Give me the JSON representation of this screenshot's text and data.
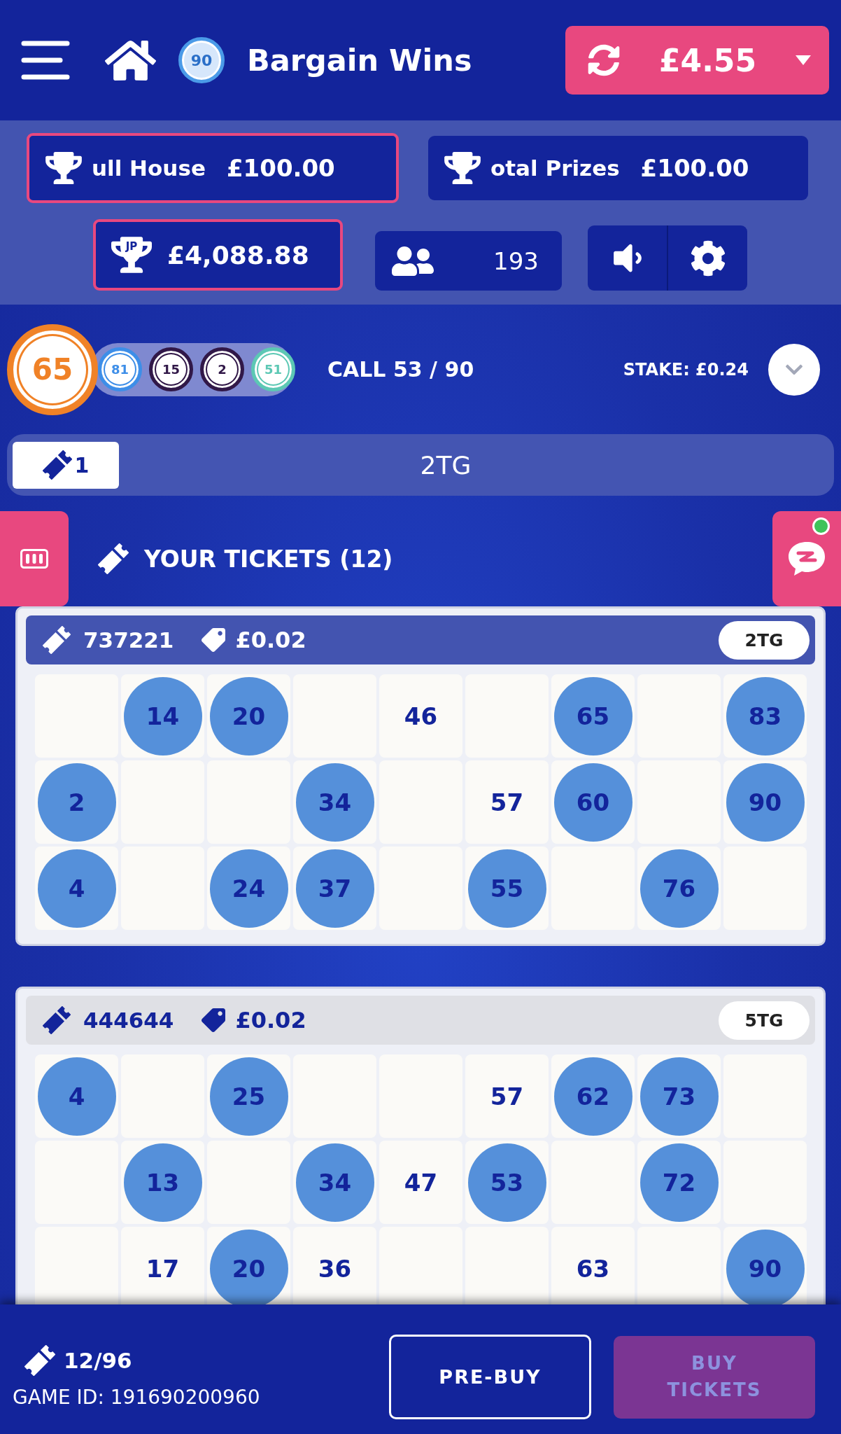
{
  "header": {
    "game_ball": "90",
    "title": "Bargain Wins",
    "balance": "£4.55"
  },
  "prizes": [
    {
      "label": "ull House",
      "amount": "£100.00",
      "highlighted": true
    },
    {
      "label": "otal Prizes",
      "amount": "£100.00",
      "highlighted": false
    }
  ],
  "jackpot": {
    "badge": "JP",
    "amount": "£4,088.88",
    "highlighted": true
  },
  "players": {
    "count": "193"
  },
  "calls": {
    "current": "65",
    "recent": [
      {
        "number": "81",
        "color": "#3d8ee8"
      },
      {
        "number": "15",
        "color": "#311848"
      },
      {
        "number": "2",
        "color": "#311848"
      },
      {
        "number": "51",
        "color": "#5cc8b4"
      }
    ],
    "progress": "CALL 53 / 90",
    "stake": "STAKE: £0.24"
  },
  "ticket_bar": {
    "count": "1",
    "label": "2TG"
  },
  "tickets_heading": "YOUR TICKETS (12)",
  "chat": {
    "notification": true
  },
  "tickets": [
    {
      "id": "737221",
      "price": "£0.02",
      "to_go": "2TG",
      "active": true,
      "rows": [
        [
          {
            "kind": "blank"
          },
          {
            "kind": "number",
            "number": "14",
            "marked": true
          },
          {
            "kind": "number",
            "number": "20",
            "marked": true
          },
          {
            "kind": "blank"
          },
          {
            "kind": "number",
            "number": "46",
            "marked": false
          },
          {
            "kind": "blank"
          },
          {
            "kind": "number",
            "number": "65",
            "marked": true
          },
          {
            "kind": "blank"
          },
          {
            "kind": "number",
            "number": "83",
            "marked": true
          }
        ],
        [
          {
            "kind": "number",
            "number": "2",
            "marked": true
          },
          {
            "kind": "blank"
          },
          {
            "kind": "blank"
          },
          {
            "kind": "number",
            "number": "34",
            "marked": true
          },
          {
            "kind": "blank"
          },
          {
            "kind": "number",
            "number": "57",
            "marked": false
          },
          {
            "kind": "number",
            "number": "60",
            "marked": true
          },
          {
            "kind": "blank"
          },
          {
            "kind": "number",
            "number": "90",
            "marked": true
          }
        ],
        [
          {
            "kind": "number",
            "number": "4",
            "marked": true
          },
          {
            "kind": "blank"
          },
          {
            "kind": "number",
            "number": "24",
            "marked": true
          },
          {
            "kind": "number",
            "number": "37",
            "marked": true
          },
          {
            "kind": "blank"
          },
          {
            "kind": "number",
            "number": "55",
            "marked": true
          },
          {
            "kind": "blank"
          },
          {
            "kind": "number",
            "number": "76",
            "marked": true
          },
          {
            "kind": "blank"
          }
        ]
      ]
    },
    {
      "id": "444644",
      "price": "£0.02",
      "to_go": "5TG",
      "active": false,
      "rows": [
        [
          {
            "kind": "number",
            "number": "4",
            "marked": true
          },
          {
            "kind": "blank"
          },
          {
            "kind": "number",
            "number": "25",
            "marked": true
          },
          {
            "kind": "blank"
          },
          {
            "kind": "blank"
          },
          {
            "kind": "number",
            "number": "57",
            "marked": false
          },
          {
            "kind": "number",
            "number": "62",
            "marked": true
          },
          {
            "kind": "number",
            "number": "73",
            "marked": true
          },
          {
            "kind": "blank"
          }
        ],
        [
          {
            "kind": "blank"
          },
          {
            "kind": "number",
            "number": "13",
            "marked": true
          },
          {
            "kind": "blank"
          },
          {
            "kind": "number",
            "number": "34",
            "marked": true
          },
          {
            "kind": "number",
            "number": "47",
            "marked": false
          },
          {
            "kind": "number",
            "number": "53",
            "marked": true
          },
          {
            "kind": "blank"
          },
          {
            "kind": "number",
            "number": "72",
            "marked": true
          },
          {
            "kind": "blank"
          }
        ],
        [
          {
            "kind": "blank"
          },
          {
            "kind": "number",
            "number": "17",
            "marked": false
          },
          {
            "kind": "number",
            "number": "20",
            "marked": true
          },
          {
            "kind": "number",
            "number": "36",
            "marked": false
          },
          {
            "kind": "blank"
          },
          {
            "kind": "blank"
          },
          {
            "kind": "number",
            "number": "63",
            "marked": false
          },
          {
            "kind": "blank"
          },
          {
            "kind": "number",
            "number": "90",
            "marked": true
          }
        ]
      ]
    }
  ],
  "footer": {
    "count": "12/96",
    "game_id": "GAME ID: 191690200960",
    "buttons": [
      {
        "label": "PRE-BUY",
        "kind": "outline",
        "disabled": false
      },
      {
        "label": "BUY TICKETS",
        "kind": "primary",
        "disabled": true
      }
    ]
  }
}
